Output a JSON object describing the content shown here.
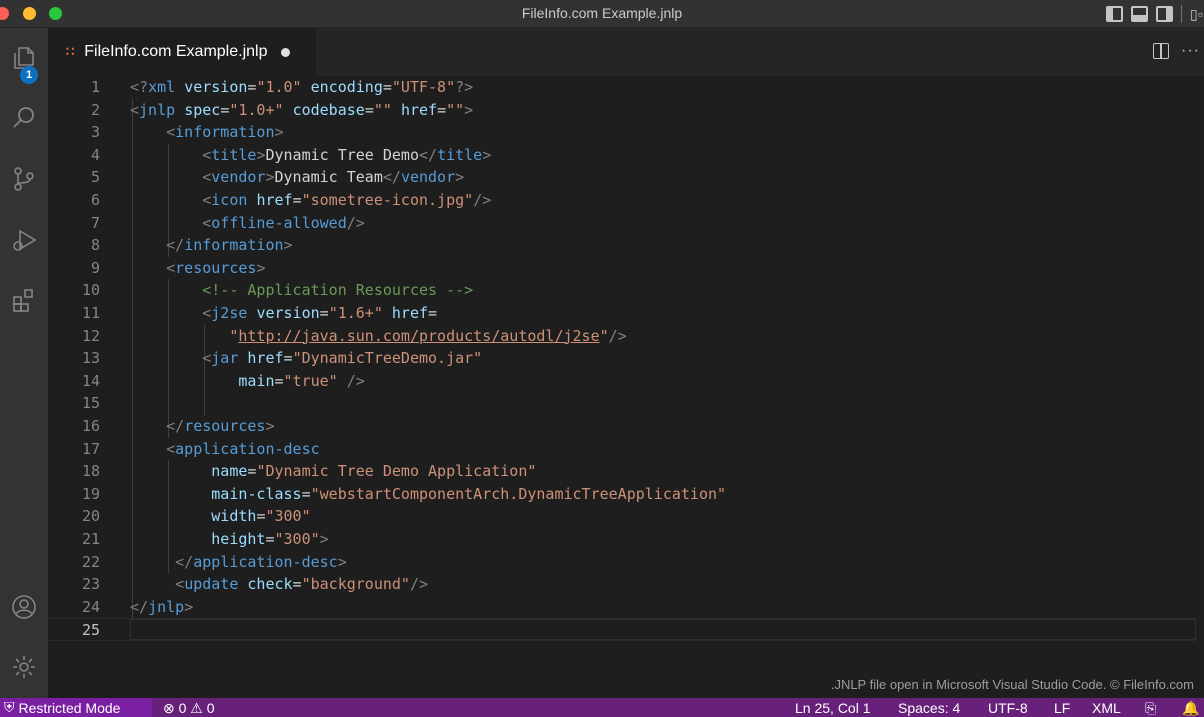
{
  "window": {
    "title": "FileInfo.com Example.jnlp"
  },
  "activity_bar": {
    "explorer_badge": "1"
  },
  "tab": {
    "label": "FileInfo.com Example.jnlp"
  },
  "tab_actions": {
    "more": "···"
  },
  "editor": {
    "line_numbers": [
      "1",
      "2",
      "3",
      "4",
      "5",
      "6",
      "7",
      "8",
      "9",
      "10",
      "11",
      "12",
      "13",
      "14",
      "15",
      "16",
      "17",
      "18",
      "19",
      "20",
      "21",
      "22",
      "23",
      "24",
      "25"
    ],
    "lines": [
      [
        [
          "p",
          "<?"
        ],
        [
          "t",
          "xml "
        ],
        [
          "a",
          "version"
        ],
        [
          "x",
          "="
        ],
        [
          "s",
          "\"1.0\""
        ],
        [
          "x",
          " "
        ],
        [
          "a",
          "encoding"
        ],
        [
          "x",
          "="
        ],
        [
          "s",
          "\"UTF-8\""
        ],
        [
          "p",
          "?>"
        ]
      ],
      [
        [
          "p",
          "<"
        ],
        [
          "t",
          "jnlp "
        ],
        [
          "a",
          "spec"
        ],
        [
          "x",
          "="
        ],
        [
          "s",
          "\"1.0+\""
        ],
        [
          "x",
          " "
        ],
        [
          "a",
          "codebase"
        ],
        [
          "x",
          "="
        ],
        [
          "s",
          "\"\""
        ],
        [
          "x",
          " "
        ],
        [
          "a",
          "href"
        ],
        [
          "x",
          "="
        ],
        [
          "s",
          "\"\""
        ],
        [
          "p",
          ">"
        ]
      ],
      [
        [
          "x",
          "    "
        ],
        [
          "p",
          "<"
        ],
        [
          "t",
          "information"
        ],
        [
          "p",
          ">"
        ]
      ],
      [
        [
          "x",
          "        "
        ],
        [
          "p",
          "<"
        ],
        [
          "t",
          "title"
        ],
        [
          "p",
          ">"
        ],
        [
          "x",
          "Dynamic Tree Demo"
        ],
        [
          "p",
          "</"
        ],
        [
          "t",
          "title"
        ],
        [
          "p",
          ">"
        ]
      ],
      [
        [
          "x",
          "        "
        ],
        [
          "p",
          "<"
        ],
        [
          "t",
          "vendor"
        ],
        [
          "p",
          ">"
        ],
        [
          "x",
          "Dynamic Team"
        ],
        [
          "p",
          "</"
        ],
        [
          "t",
          "vendor"
        ],
        [
          "p",
          ">"
        ]
      ],
      [
        [
          "x",
          "        "
        ],
        [
          "p",
          "<"
        ],
        [
          "t",
          "icon "
        ],
        [
          "a",
          "href"
        ],
        [
          "x",
          "="
        ],
        [
          "s",
          "\"sometree-icon.jpg\""
        ],
        [
          "p",
          "/>"
        ]
      ],
      [
        [
          "x",
          "        "
        ],
        [
          "p",
          "<"
        ],
        [
          "t",
          "offline-allowed"
        ],
        [
          "p",
          "/>"
        ]
      ],
      [
        [
          "x",
          "    "
        ],
        [
          "p",
          "</"
        ],
        [
          "t",
          "information"
        ],
        [
          "p",
          ">"
        ]
      ],
      [
        [
          "x",
          "    "
        ],
        [
          "p",
          "<"
        ],
        [
          "t",
          "resources"
        ],
        [
          "p",
          ">"
        ]
      ],
      [
        [
          "x",
          "        "
        ],
        [
          "c",
          "<!-- Application Resources -->"
        ]
      ],
      [
        [
          "x",
          "        "
        ],
        [
          "p",
          "<"
        ],
        [
          "t",
          "j2se "
        ],
        [
          "a",
          "version"
        ],
        [
          "x",
          "="
        ],
        [
          "s",
          "\"1.6+\""
        ],
        [
          "x",
          " "
        ],
        [
          "a",
          "href"
        ],
        [
          "x",
          "="
        ]
      ],
      [
        [
          "x",
          "           "
        ],
        [
          "s",
          "\""
        ],
        [
          "su",
          "http://java.sun.com/products/autodl/j2se"
        ],
        [
          "s",
          "\""
        ],
        [
          "p",
          "/>"
        ]
      ],
      [
        [
          "x",
          "        "
        ],
        [
          "p",
          "<"
        ],
        [
          "t",
          "jar "
        ],
        [
          "a",
          "href"
        ],
        [
          "x",
          "="
        ],
        [
          "s",
          "\"DynamicTreeDemo.jar\""
        ]
      ],
      [
        [
          "x",
          "            "
        ],
        [
          "a",
          "main"
        ],
        [
          "x",
          "="
        ],
        [
          "s",
          "\"true\""
        ],
        [
          "x",
          " "
        ],
        [
          "p",
          "/>"
        ]
      ],
      [],
      [
        [
          "x",
          "    "
        ],
        [
          "p",
          "</"
        ],
        [
          "t",
          "resources"
        ],
        [
          "p",
          ">"
        ]
      ],
      [
        [
          "x",
          "    "
        ],
        [
          "p",
          "<"
        ],
        [
          "t",
          "application-desc"
        ]
      ],
      [
        [
          "x",
          "         "
        ],
        [
          "a",
          "name"
        ],
        [
          "x",
          "="
        ],
        [
          "s",
          "\"Dynamic Tree Demo Application\""
        ]
      ],
      [
        [
          "x",
          "         "
        ],
        [
          "a",
          "main-class"
        ],
        [
          "x",
          "="
        ],
        [
          "s",
          "\"webstartComponentArch.DynamicTreeApplication\""
        ]
      ],
      [
        [
          "x",
          "         "
        ],
        [
          "a",
          "width"
        ],
        [
          "x",
          "="
        ],
        [
          "s",
          "\"300\""
        ]
      ],
      [
        [
          "x",
          "         "
        ],
        [
          "a",
          "height"
        ],
        [
          "x",
          "="
        ],
        [
          "s",
          "\"300\""
        ],
        [
          "p",
          ">"
        ]
      ],
      [
        [
          "x",
          "     "
        ],
        [
          "p",
          "</"
        ],
        [
          "t",
          "application-desc"
        ],
        [
          "p",
          ">"
        ]
      ],
      [
        [
          "x",
          "     "
        ],
        [
          "p",
          "<"
        ],
        [
          "t",
          "update "
        ],
        [
          "a",
          "check"
        ],
        [
          "x",
          "="
        ],
        [
          "s",
          "\"background\""
        ],
        [
          "p",
          "/>"
        ]
      ],
      [
        [
          "p",
          "</"
        ],
        [
          "t",
          "jnlp"
        ],
        [
          "p",
          ">"
        ]
      ],
      []
    ]
  },
  "watermark": ".JNLP file open in Microsoft Visual Studio Code. © FileInfo.com",
  "statusbar": {
    "restricted": "Restricted Mode",
    "problems": "⊗ 0 ⚠ 0",
    "position": "Ln 25, Col 1",
    "spaces": "Spaces: 4",
    "encoding": "UTF-8",
    "eol": "LF",
    "language": "XML"
  },
  "colors": {
    "statusbar": "#68217a",
    "tag": "#569cd6",
    "attribute": "#9cdcfe",
    "string": "#ce9178",
    "comment": "#6a9955"
  }
}
